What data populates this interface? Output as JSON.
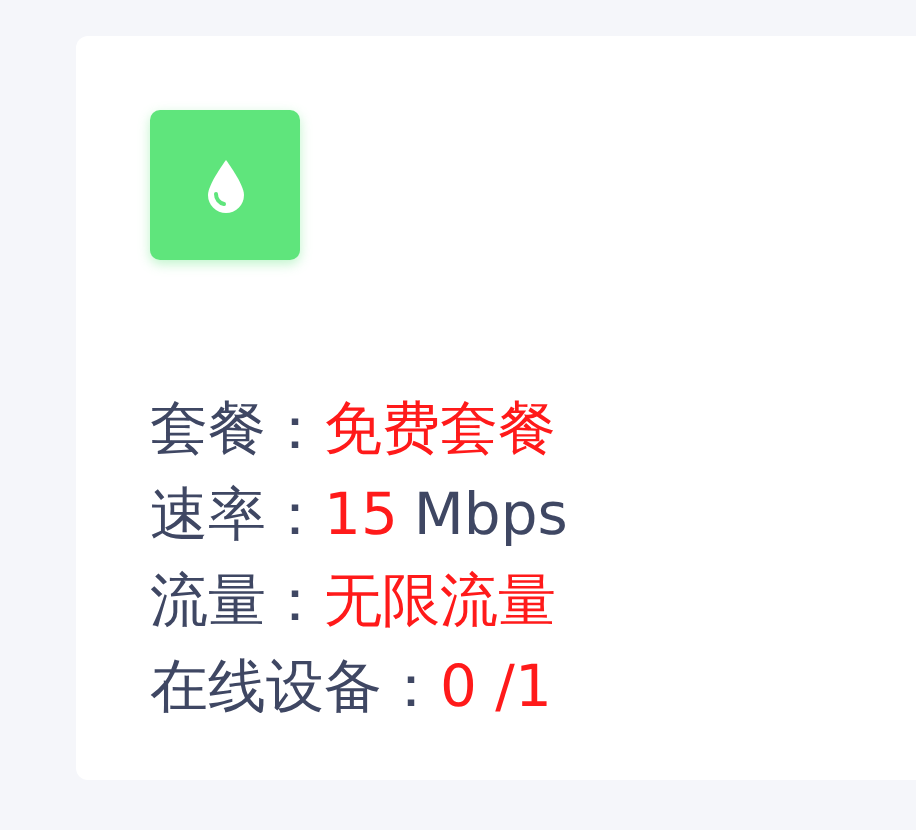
{
  "card": {
    "rows": [
      {
        "label": "套餐：",
        "value": "免费套餐"
      },
      {
        "label": "速率：",
        "value": "15",
        "unit": "Mbps"
      },
      {
        "label": "流量：",
        "value": "无限流量"
      },
      {
        "label": "在线设备：",
        "value": "0 /1"
      }
    ]
  }
}
